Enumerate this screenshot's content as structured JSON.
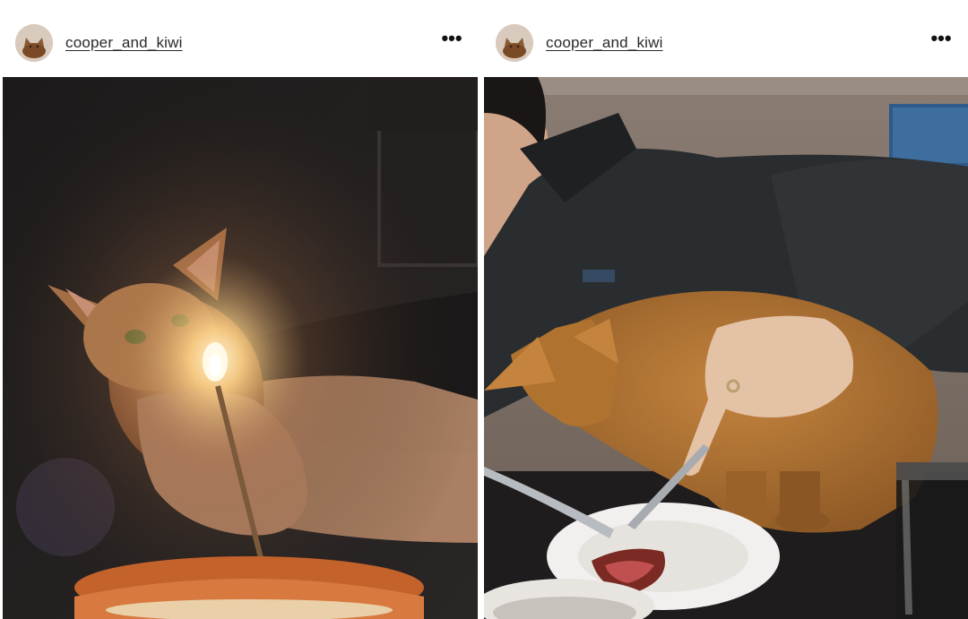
{
  "posts": [
    {
      "username": "cooper_and_kiwi",
      "more_label": "•••",
      "photo_description": "cat-with-birthday-candle-and-cake"
    },
    {
      "username": "cooper_and_kiwi",
      "more_label": "•••",
      "photo_description": "man-cutting-steak-with-cat-on-table"
    }
  ],
  "icons": {
    "more": "more-options-icon",
    "avatar": "cat-avatar"
  },
  "colors": {
    "username": "#2a2a2a",
    "background": "#ffffff"
  }
}
